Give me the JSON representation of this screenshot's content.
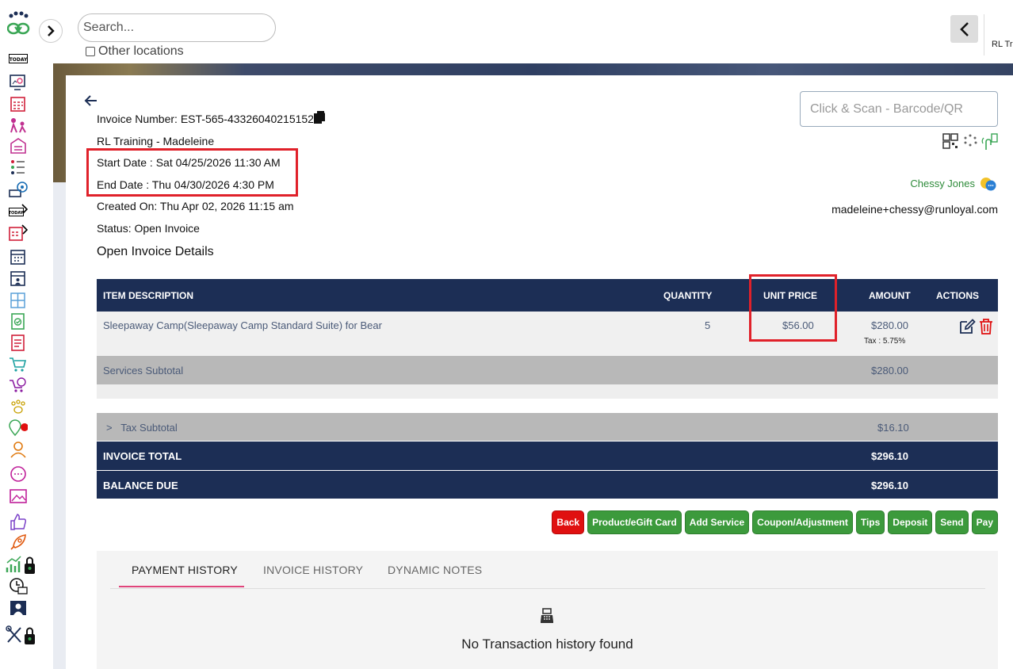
{
  "header": {
    "search_placeholder": "Search...",
    "other_locations_label": "Other locations",
    "user_short": "RL Tr"
  },
  "sidebar": {
    "icons": [
      "logo-paw-heart-icon",
      "today-icon",
      "dashboard-icon",
      "calendar-grid-icon",
      "pets-play-icon",
      "kennel-icon",
      "checklist-icon",
      "dog-house-icon",
      "today-tag-icon",
      "calendar-tag-icon",
      "calendar-icon",
      "calendar-person-icon",
      "grid-layout-icon",
      "clipboard-check-icon",
      "form-icon",
      "cart-icon",
      "cart-clock-icon",
      "paws-icon",
      "location-alert-icon",
      "user-icon",
      "chat-bubble-icon",
      "image-icon",
      "thumbs-up-icon",
      "rocket-icon",
      "chart-lock-icon",
      "clock-cash-icon",
      "person-board-icon",
      "tools-lock-icon"
    ]
  },
  "invoice": {
    "number_label": "Invoice Number: EST-565-433260402151528",
    "location": "RL Training - Madeleine",
    "start_date": "Start Date : Sat 04/25/2026 11:30 AM",
    "end_date": "End Date : Thu 04/30/2026 4:30 PM",
    "created_on": "Created On: Thu Apr 02, 2026 11:15 am",
    "status": "Status: Open Invoice",
    "details_title": "Open Invoice Details"
  },
  "scan": {
    "placeholder": "Click & Scan - Barcode/QR"
  },
  "customer": {
    "name": "Chessy Jones",
    "email": "madeleine+chessy@runloyal.com"
  },
  "table": {
    "headers": {
      "item": "ITEM DESCRIPTION",
      "quantity": "QUANTITY",
      "unit_price": "UNIT PRICE",
      "amount": "AMOUNT",
      "actions": "ACTIONS"
    },
    "items": [
      {
        "description": "Sleepaway Camp(Sleepaway Camp Standard Suite) for Bear",
        "quantity": "5",
        "unit_price": "$56.00",
        "amount": "$280.00",
        "tax": "Tax : 5.75%"
      }
    ],
    "services_subtotal_label": "Services Subtotal",
    "services_subtotal": "$280.00",
    "tax_subtotal_label": ">   Tax Subtotal",
    "tax_subtotal": "$16.10",
    "invoice_total_label": "INVOICE TOTAL",
    "invoice_total": "$296.10",
    "balance_due_label": "BALANCE DUE",
    "balance_due": "$296.10"
  },
  "buttons": {
    "back": "Back",
    "product": "Product/eGift Card",
    "add_service": "Add Service",
    "coupon": "Coupon/Adjustment",
    "tips": "Tips",
    "deposit": "Deposit",
    "send": "Send",
    "pay": "Pay"
  },
  "history": {
    "tabs": [
      "PAYMENT HISTORY",
      "INVOICE HISTORY",
      "DYNAMIC NOTES"
    ],
    "empty_message": "No Transaction history found"
  },
  "colors": {
    "navy": "#1c2e55",
    "green": "#3c9a3c",
    "red": "#e01010",
    "highlight_red": "#e0212a",
    "tab_accent": "#e0457b"
  }
}
